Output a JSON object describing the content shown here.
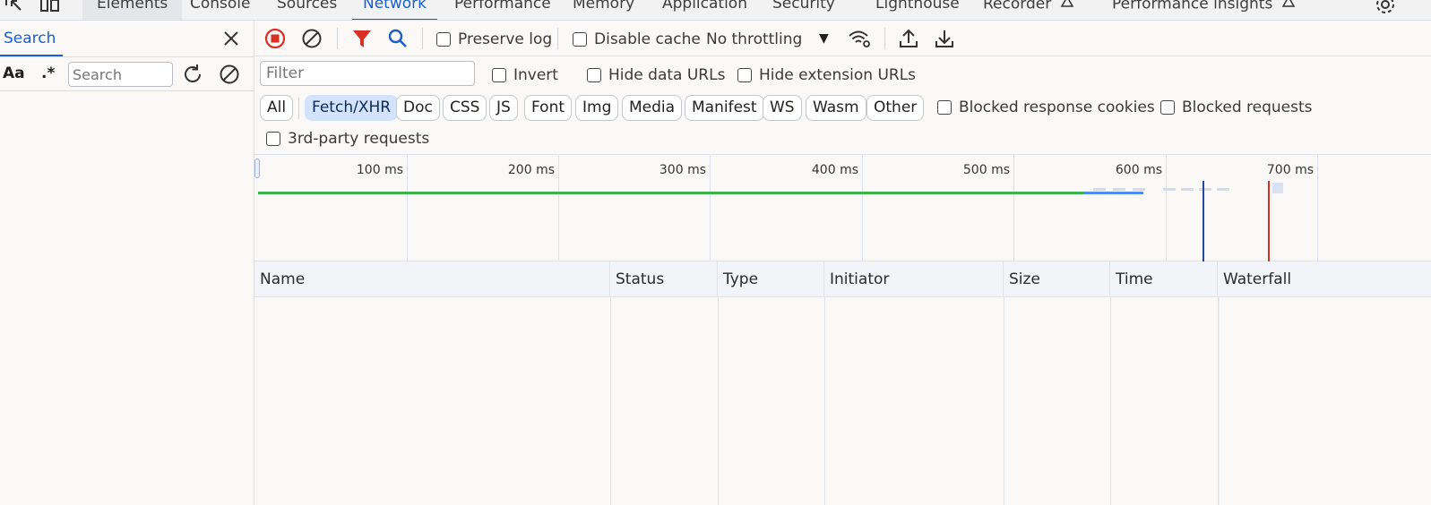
{
  "tabs": [
    {
      "label": "Elements"
    },
    {
      "label": "Console"
    },
    {
      "label": "Sources"
    },
    {
      "label": "Network"
    },
    {
      "label": "Performance"
    },
    {
      "label": "Memory"
    },
    {
      "label": "Application"
    },
    {
      "label": "Security"
    },
    {
      "label": "Lighthouse"
    },
    {
      "label": "Recorder"
    },
    {
      "label": "Performance insights"
    }
  ],
  "search_panel": {
    "tab_label": "Search",
    "case_toggle": "Aa",
    "regex_toggle": ".*",
    "input_placeholder": "Search"
  },
  "toolbar": {
    "preserve_log": "Preserve log",
    "disable_cache": "Disable cache",
    "throttling": "No throttling",
    "filter_placeholder": "Filter",
    "invert": "Invert",
    "hide_data_urls": "Hide data URLs",
    "hide_extension_urls": "Hide extension URLs",
    "blocked_response_cookies": "Blocked response cookies",
    "blocked_requests": "Blocked requests",
    "third_party": "3rd-party requests",
    "colors": {
      "record": "#d93025",
      "filter_active": "#d93025",
      "search": "#1a5fcb",
      "accent": "#1a5fcb"
    }
  },
  "type_filters": [
    {
      "label": "All",
      "selected": false
    },
    {
      "label": "Fetch/XHR",
      "selected": true
    },
    {
      "label": "Doc",
      "selected": false
    },
    {
      "label": "CSS",
      "selected": false
    },
    {
      "label": "JS",
      "selected": false
    },
    {
      "label": "Font",
      "selected": false
    },
    {
      "label": "Img",
      "selected": false
    },
    {
      "label": "Media",
      "selected": false
    },
    {
      "label": "Manifest",
      "selected": false
    },
    {
      "label": "WS",
      "selected": false
    },
    {
      "label": "Wasm",
      "selected": false
    },
    {
      "label": "Other",
      "selected": false
    }
  ],
  "overview": {
    "ticks": [
      "100 ms",
      "200 ms",
      "300 ms",
      "400 ms",
      "500 ms",
      "600 ms",
      "700 ms"
    ]
  },
  "columns": [
    "Name",
    "Status",
    "Type",
    "Initiator",
    "Size",
    "Time",
    "Waterfall"
  ]
}
